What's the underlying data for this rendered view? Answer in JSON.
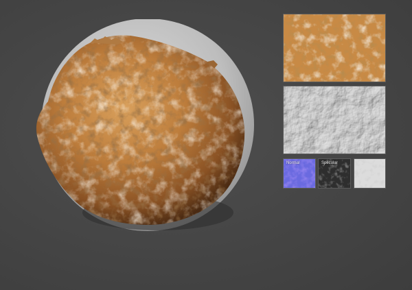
{
  "viewport": {
    "background_color": "#4a4a4a"
  },
  "preview": {
    "backplate_color": "#c9c9c9",
    "rock_base_color": "#b97a3a",
    "rock_highlight_color": "#e9d7b8",
    "rock_shadow_color": "#5a3518"
  },
  "maps": [
    {
      "id": "albedo",
      "label": "",
      "icon": "albedo-map",
      "color": "#c88a45"
    },
    {
      "id": "height",
      "label": "",
      "icon": "height-map",
      "color": "#cfcfcf"
    },
    {
      "id": "normal",
      "label": "Normal",
      "icon": "normal-map",
      "color": "#6a6ae0"
    },
    {
      "id": "specular",
      "label": "Specular",
      "icon": "specular-map",
      "color": "#3a3a3a"
    },
    {
      "id": "roughness",
      "label": "",
      "icon": "roughness-map",
      "color": "#dcdcdc"
    }
  ]
}
